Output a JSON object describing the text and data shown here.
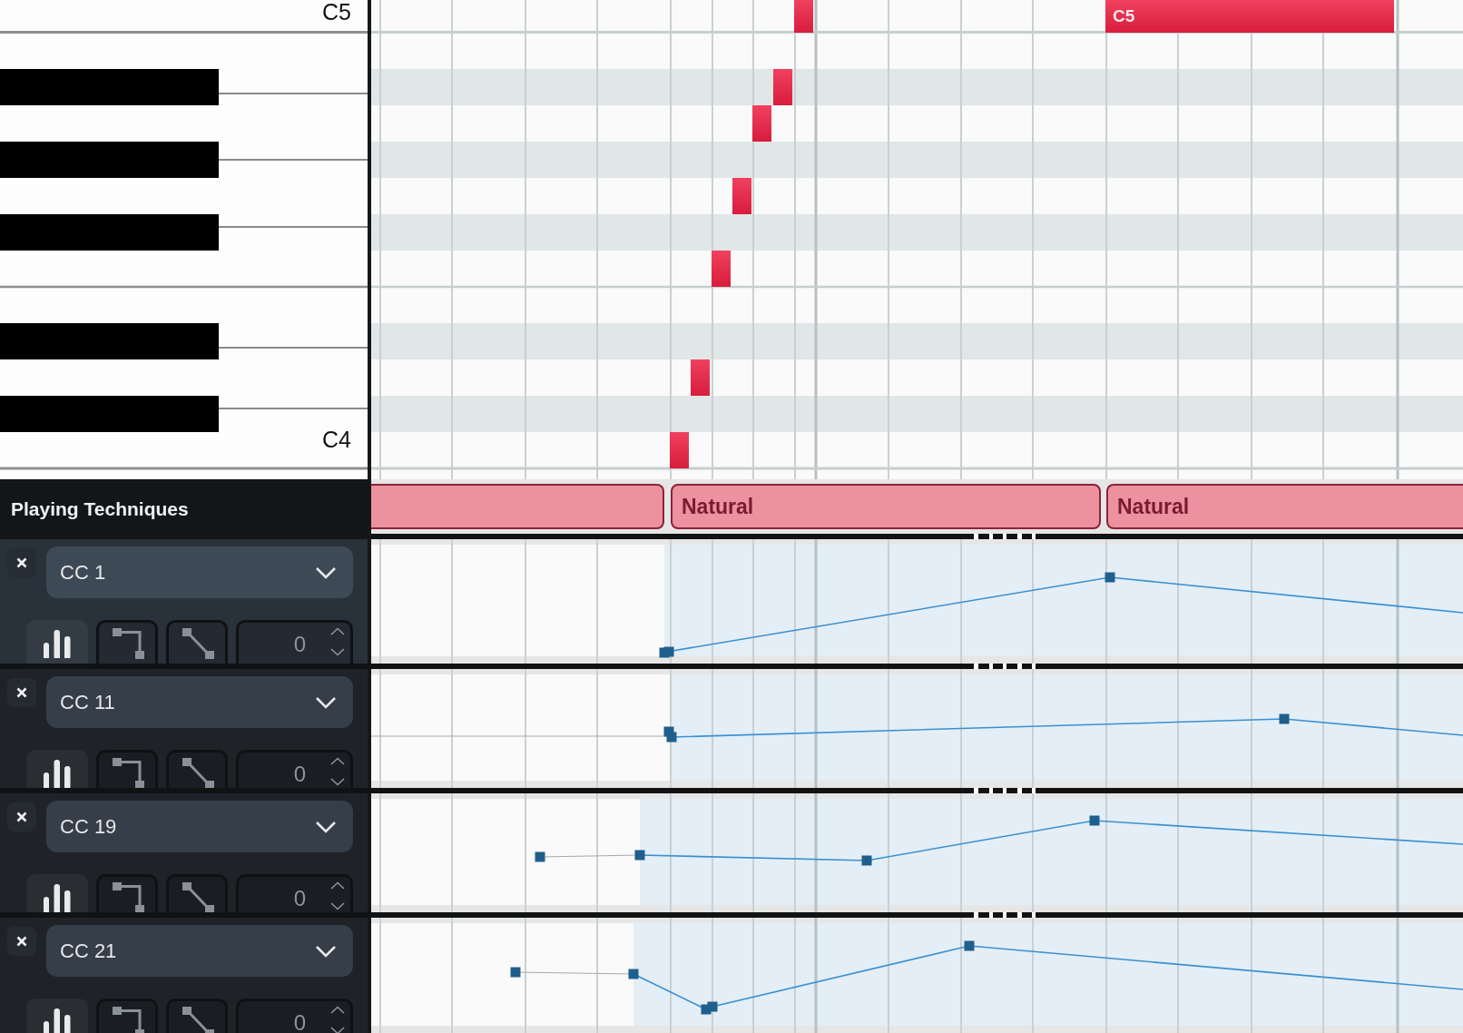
{
  "piano_roll": {
    "key_labels": [
      "C5",
      "C4"
    ],
    "notes": [
      {
        "selected": false
      },
      {
        "selected": false
      },
      {
        "selected": false
      },
      {
        "selected": false
      },
      {
        "selected": false
      },
      {
        "selected": false
      },
      {
        "selected": false
      },
      {
        "selected": false,
        "label": "C5"
      }
    ]
  },
  "playing_techniques": {
    "title": "Playing Techniques",
    "blocks": [
      {
        "selected": false
      },
      {
        "selected": false,
        "label": "Natural"
      },
      {
        "selected": false,
        "label": "Natural"
      }
    ]
  },
  "cc_lanes": [
    {
      "controller": "CC 1",
      "selected": true,
      "tools": [
        {
          "kind": "bars",
          "selected": true
        },
        {
          "kind": "step",
          "selected": false
        },
        {
          "kind": "linear",
          "selected": false
        }
      ],
      "value": "0"
    },
    {
      "controller": "CC 11",
      "selected": false,
      "tools": [
        {
          "kind": "bars",
          "selected": true
        },
        {
          "kind": "step",
          "selected": false
        },
        {
          "kind": "linear",
          "selected": false
        }
      ],
      "value": "0"
    },
    {
      "controller": "CC 19",
      "selected": false,
      "tools": [
        {
          "kind": "bars",
          "selected": true
        },
        {
          "kind": "step",
          "selected": false
        },
        {
          "kind": "linear",
          "selected": false
        }
      ],
      "value": "0"
    },
    {
      "controller": "CC 21",
      "selected": false,
      "tools": [
        {
          "kind": "bars",
          "selected": true
        },
        {
          "kind": "step",
          "selected": false
        },
        {
          "kind": "linear",
          "selected": false
        }
      ],
      "value": "0"
    }
  ]
}
